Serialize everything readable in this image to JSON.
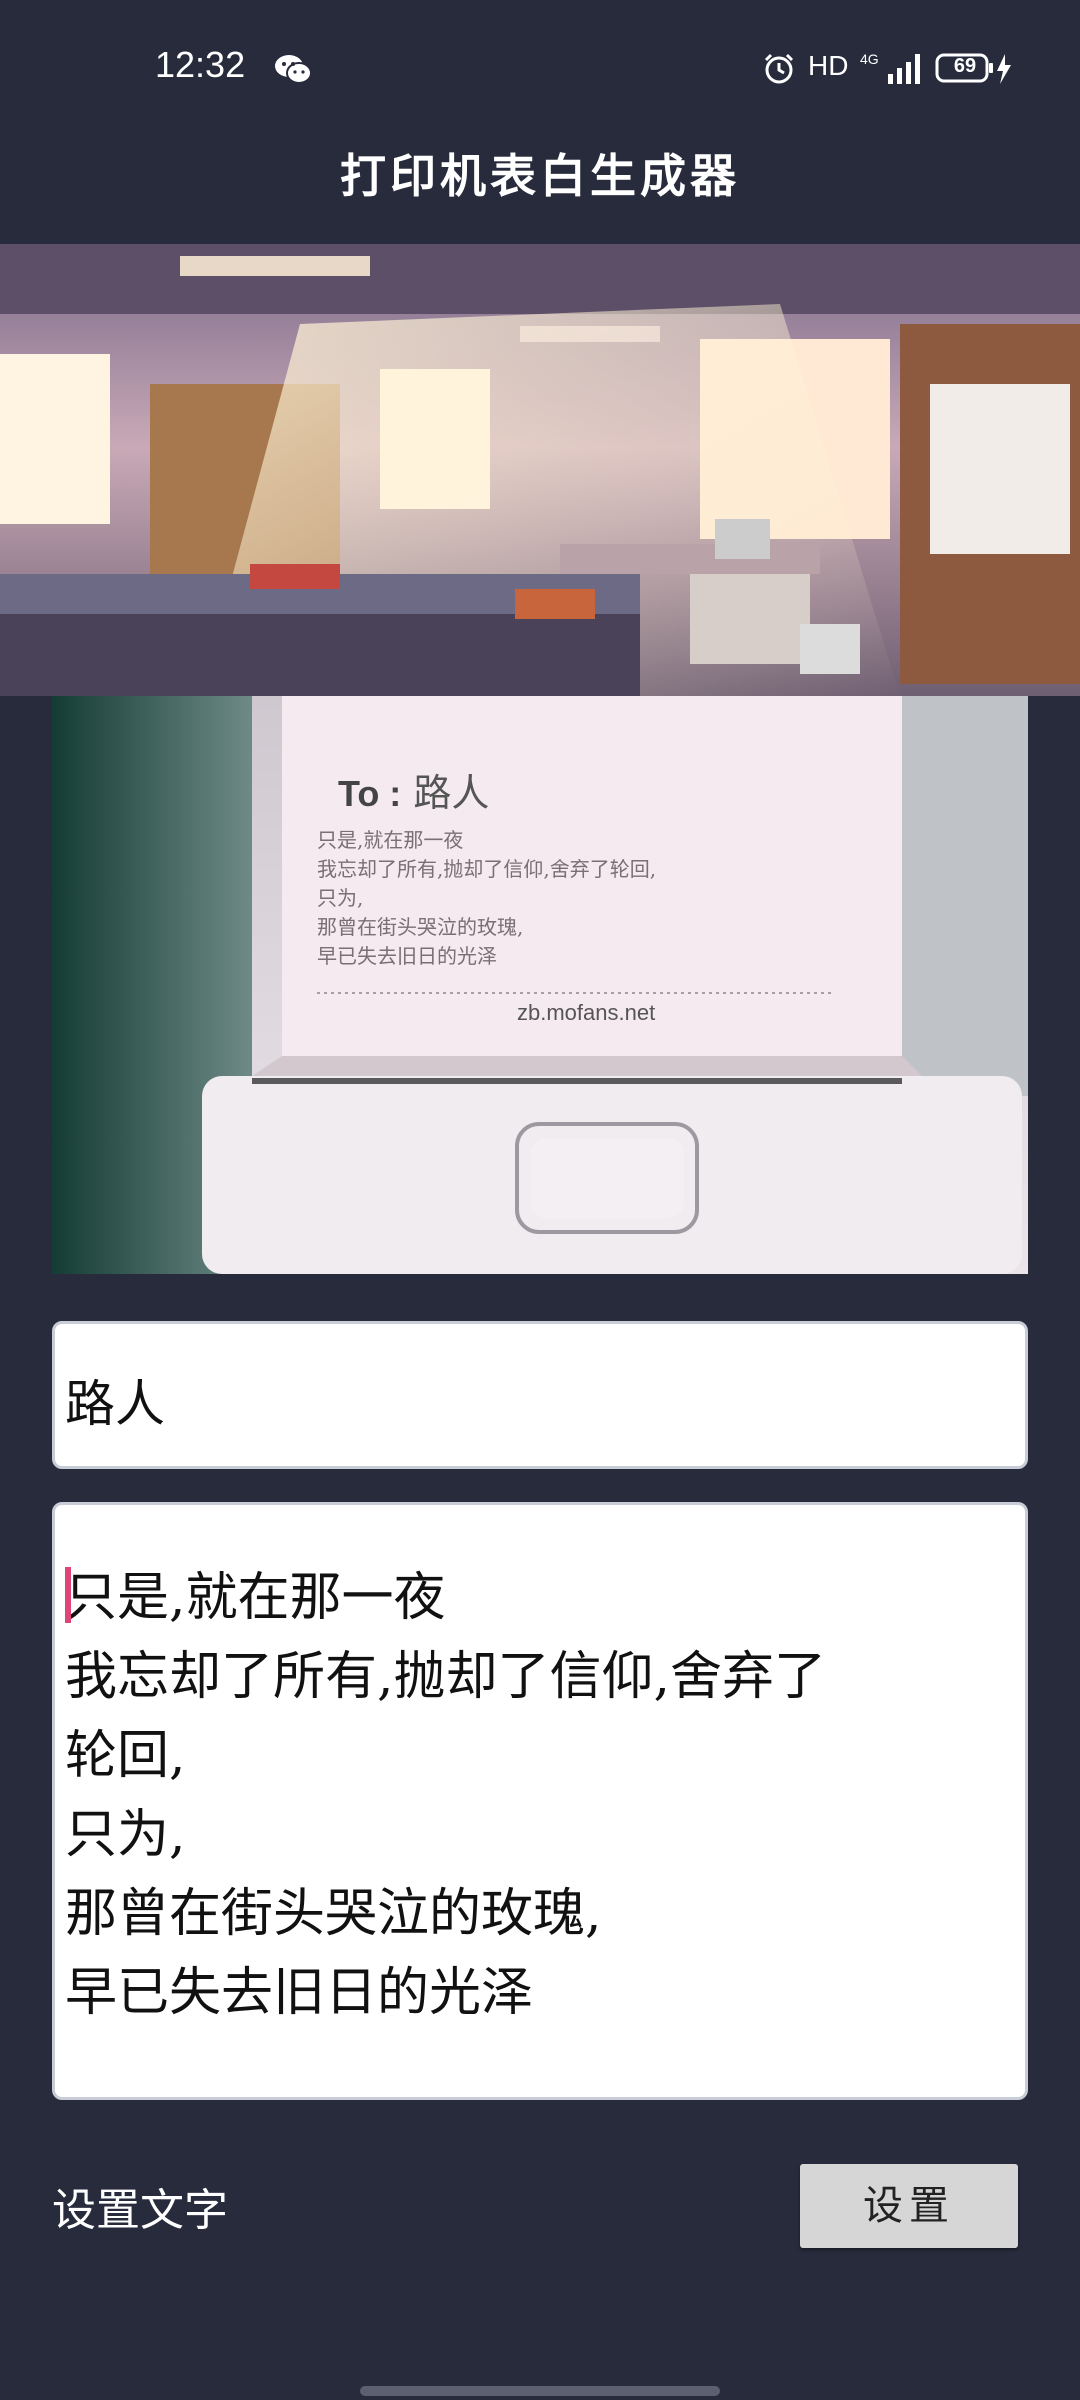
{
  "status_bar": {
    "time": "12:32",
    "network": "HD",
    "signal_type": "4G",
    "battery_level": "69",
    "icons": [
      "wechat-icon",
      "alarm-icon",
      "signal-icon",
      "battery-icon",
      "charging-icon"
    ]
  },
  "app": {
    "title": "打印机表白生成器"
  },
  "preview": {
    "to_prefix": "To :",
    "to_name": "路人",
    "lines": [
      "只是,就在那一夜",
      "我忘却了所有,抛却了信仰,舍弃了轮回,",
      "只为,",
      "那曾在街头哭泣的玫瑰,",
      "早已失去旧日的光泽"
    ],
    "url": "zb.mofans.net"
  },
  "form": {
    "name_value": "路人",
    "message_lines": [
      "只是,就在那一夜",
      "我忘却了所有,抛却了信仰,舍弃了",
      "轮回,",
      "只为,",
      "那曾在街头哭泣的玫瑰,",
      "早已失去旧日的光泽"
    ],
    "settings_label": "设置文字",
    "set_button": "设置"
  },
  "colors": {
    "background": "#272b3c",
    "input_bg": "#ffffff",
    "button_bg": "#d6d6d6",
    "cursor": "#e0457a"
  }
}
